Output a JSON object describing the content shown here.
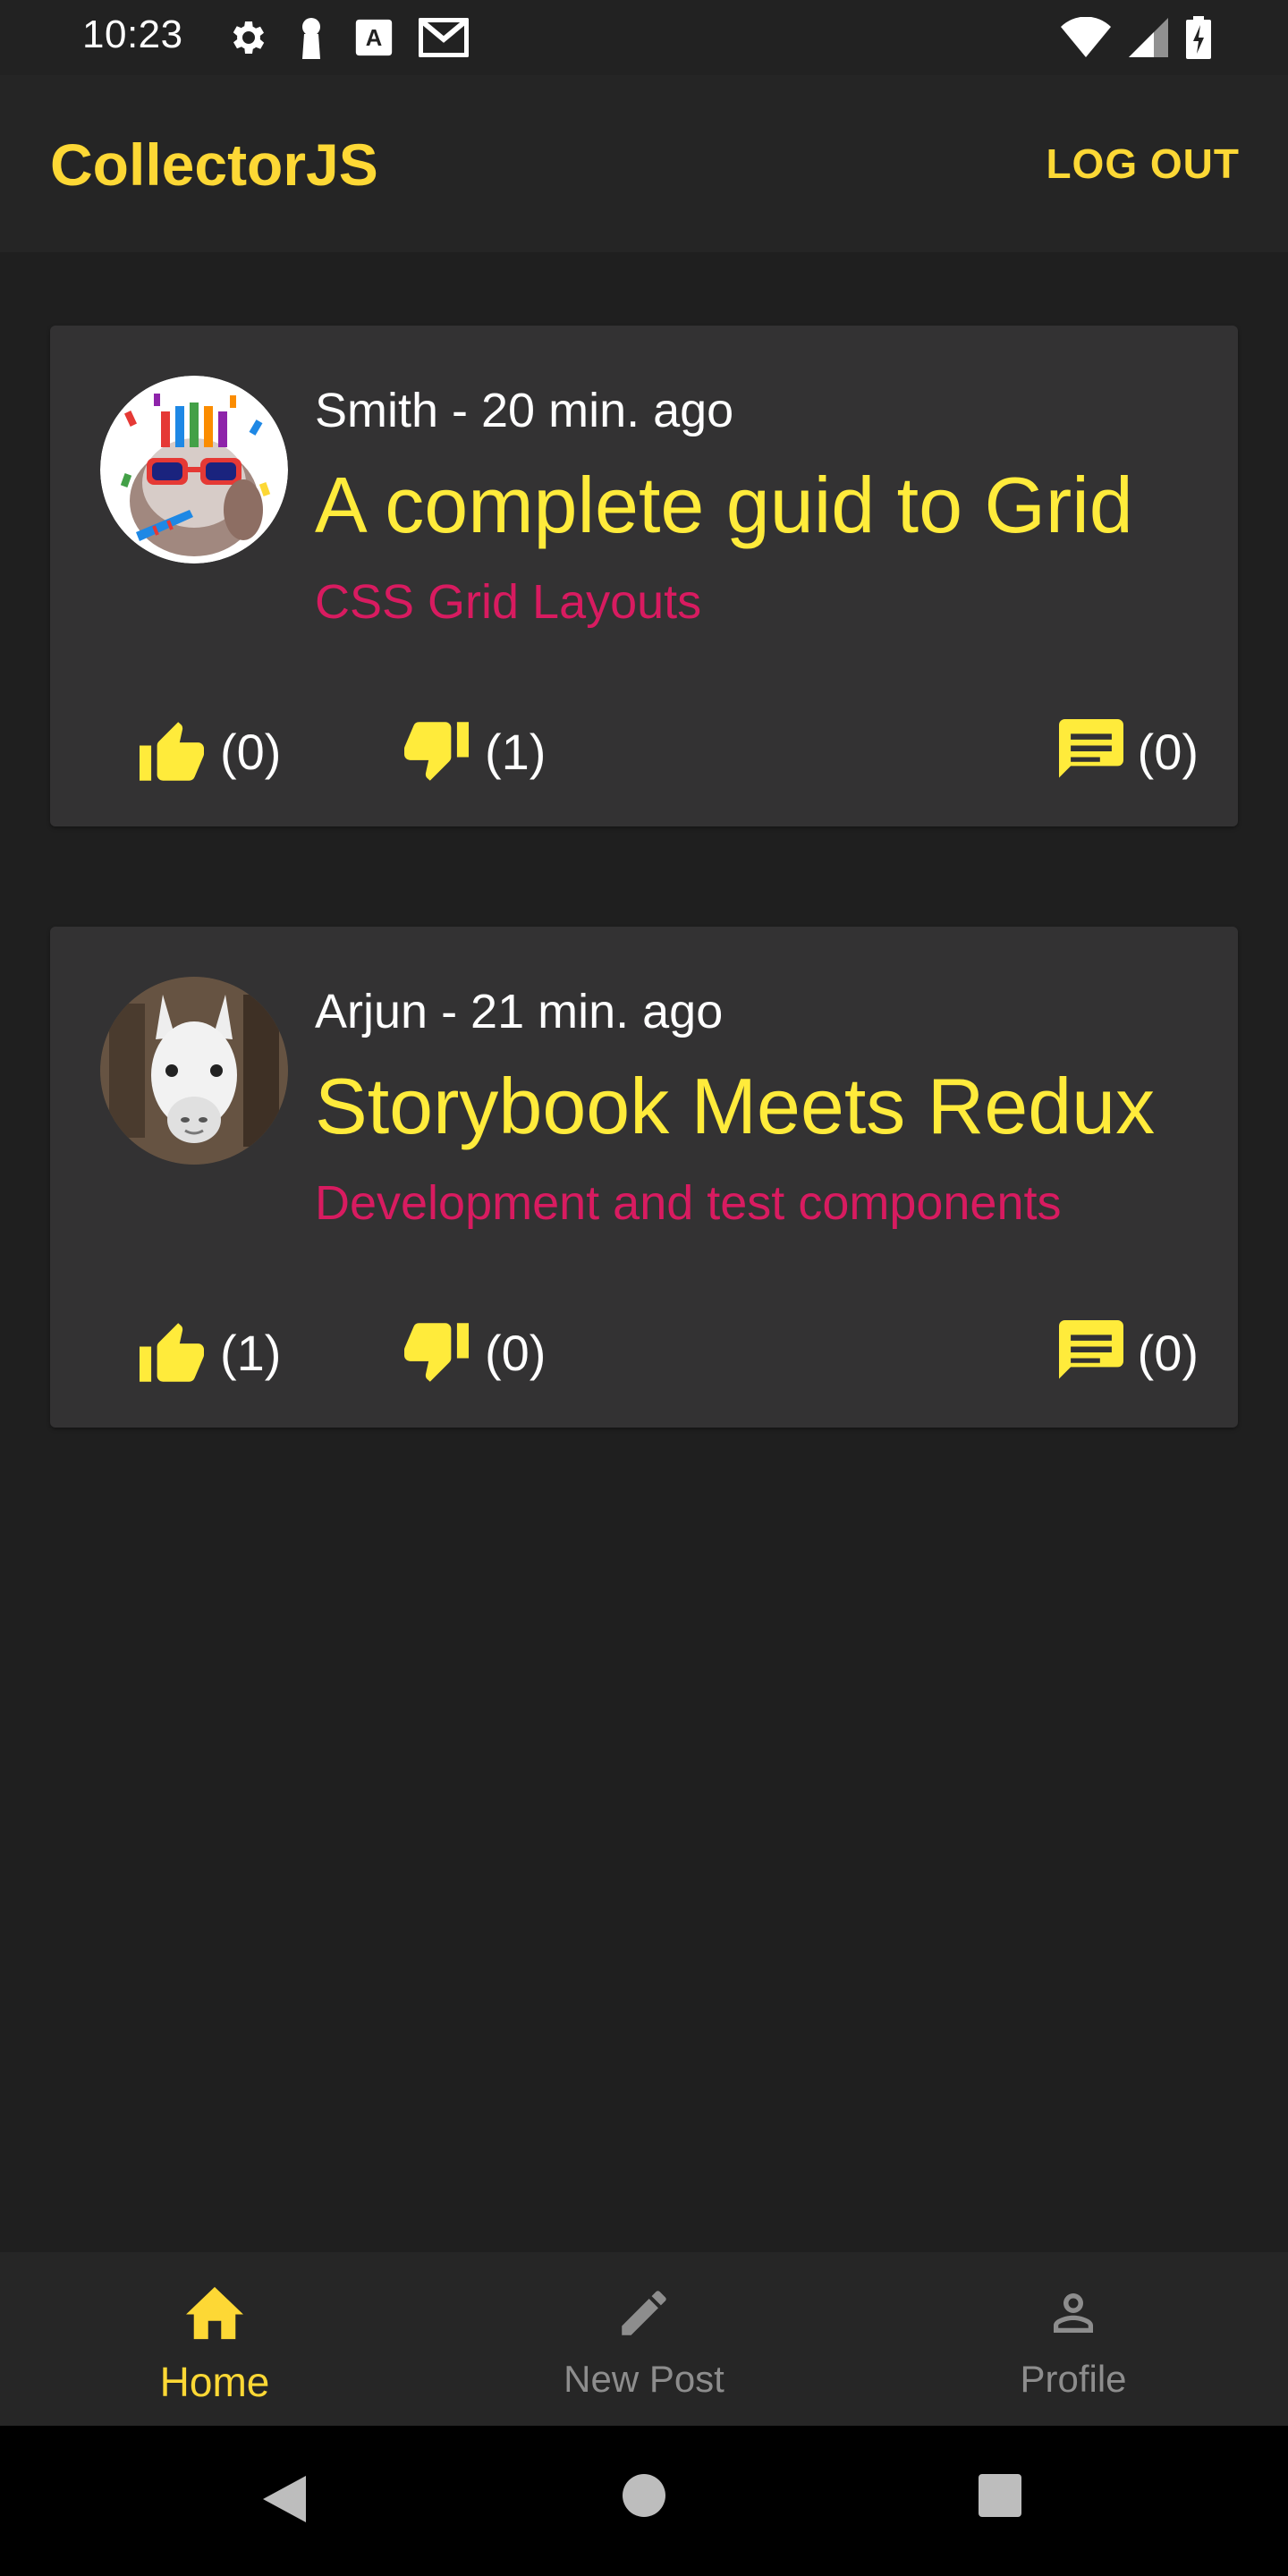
{
  "status_bar": {
    "time": "10:23",
    "left_icons": [
      "settings-icon",
      "keyhole-icon",
      "keyboard-a-icon",
      "gmail-icon"
    ],
    "right_icons": [
      "wifi-icon",
      "cell-signal-icon",
      "battery-charging-icon"
    ]
  },
  "app_bar": {
    "title": "CollectorJS",
    "logout_label": "LOG OUT",
    "accent_color": "#fdd835"
  },
  "posts": [
    {
      "author": "Smith",
      "meta": "Smith - 20 min. ago",
      "title": "A complete guid to Grid",
      "subtitle": "CSS Grid Layouts",
      "likes": "(0)",
      "dislikes": "(1)",
      "comments": "(0)",
      "avatar": "party-sloth-avatar"
    },
    {
      "author": "Arjun",
      "meta": "Arjun - 21 min. ago",
      "title": "Storybook Meets Redux",
      "subtitle": "Development and test components",
      "likes": "(1)",
      "dislikes": "(0)",
      "comments": "(0)",
      "avatar": "llama-avatar"
    }
  ],
  "bottom_nav": {
    "items": [
      {
        "label": "Home",
        "icon": "home-icon",
        "active": true
      },
      {
        "label": "New Post",
        "icon": "pencil-icon",
        "active": false
      },
      {
        "label": "Profile",
        "icon": "person-icon",
        "active": false
      }
    ]
  },
  "system_nav": {
    "buttons": [
      "back-icon",
      "home-circle-icon",
      "recents-square-icon"
    ]
  },
  "colors": {
    "title_yellow": "#ffeb3b",
    "subtitle_pink": "#d81b60",
    "card_bg": "#333233"
  }
}
